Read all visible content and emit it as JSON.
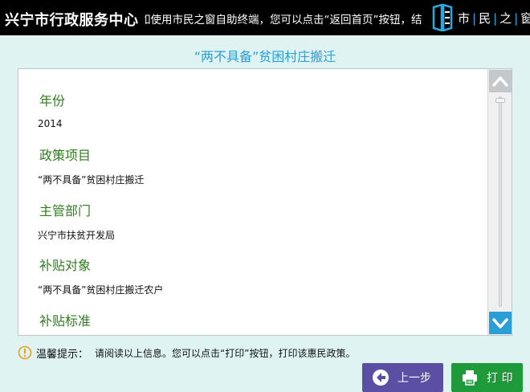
{
  "header": {
    "app_title": "兴宁市行政服务中心",
    "marquee": "如使用市民之窗自助终端，您可以点击“返回首页”按钮，结束当",
    "brand": [
      "市",
      "民",
      "之",
      "窗"
    ]
  },
  "page_title": "“两不具备”贫困村庄搬迁",
  "sections": [
    {
      "heading": "年份",
      "value": "2014"
    },
    {
      "heading": "政策项目",
      "value": "“两不具备”贫困村庄搬迁"
    },
    {
      "heading": "主管部门",
      "value": "兴宁市扶贫开发局"
    },
    {
      "heading": "补贴对象",
      "value": "“两不具备”贫困村庄搬迁农户"
    },
    {
      "heading": "补贴标准",
      "value": ""
    }
  ],
  "tip": {
    "label": "温馨提示：",
    "text": "请阅读以上信息。您可以点击“打印”按钮，打印该惠民政策。"
  },
  "buttons": {
    "prev": "上一步",
    "print": "打 印"
  },
  "colors": {
    "background": "#dff3f3",
    "title": "#2a9fd6",
    "heading": "#2e7d1d",
    "prev_button": "#5b4fa3",
    "print_button": "#1f9a3a",
    "warning": "#e6a21a"
  },
  "icons": {
    "scroll_up": "chevron-up-icon",
    "scroll_down": "chevron-down-icon",
    "tip": "info-warning-icon",
    "prev": "arrow-left-circle-icon",
    "print": "printer-icon",
    "brand": "window-logo-icon"
  }
}
